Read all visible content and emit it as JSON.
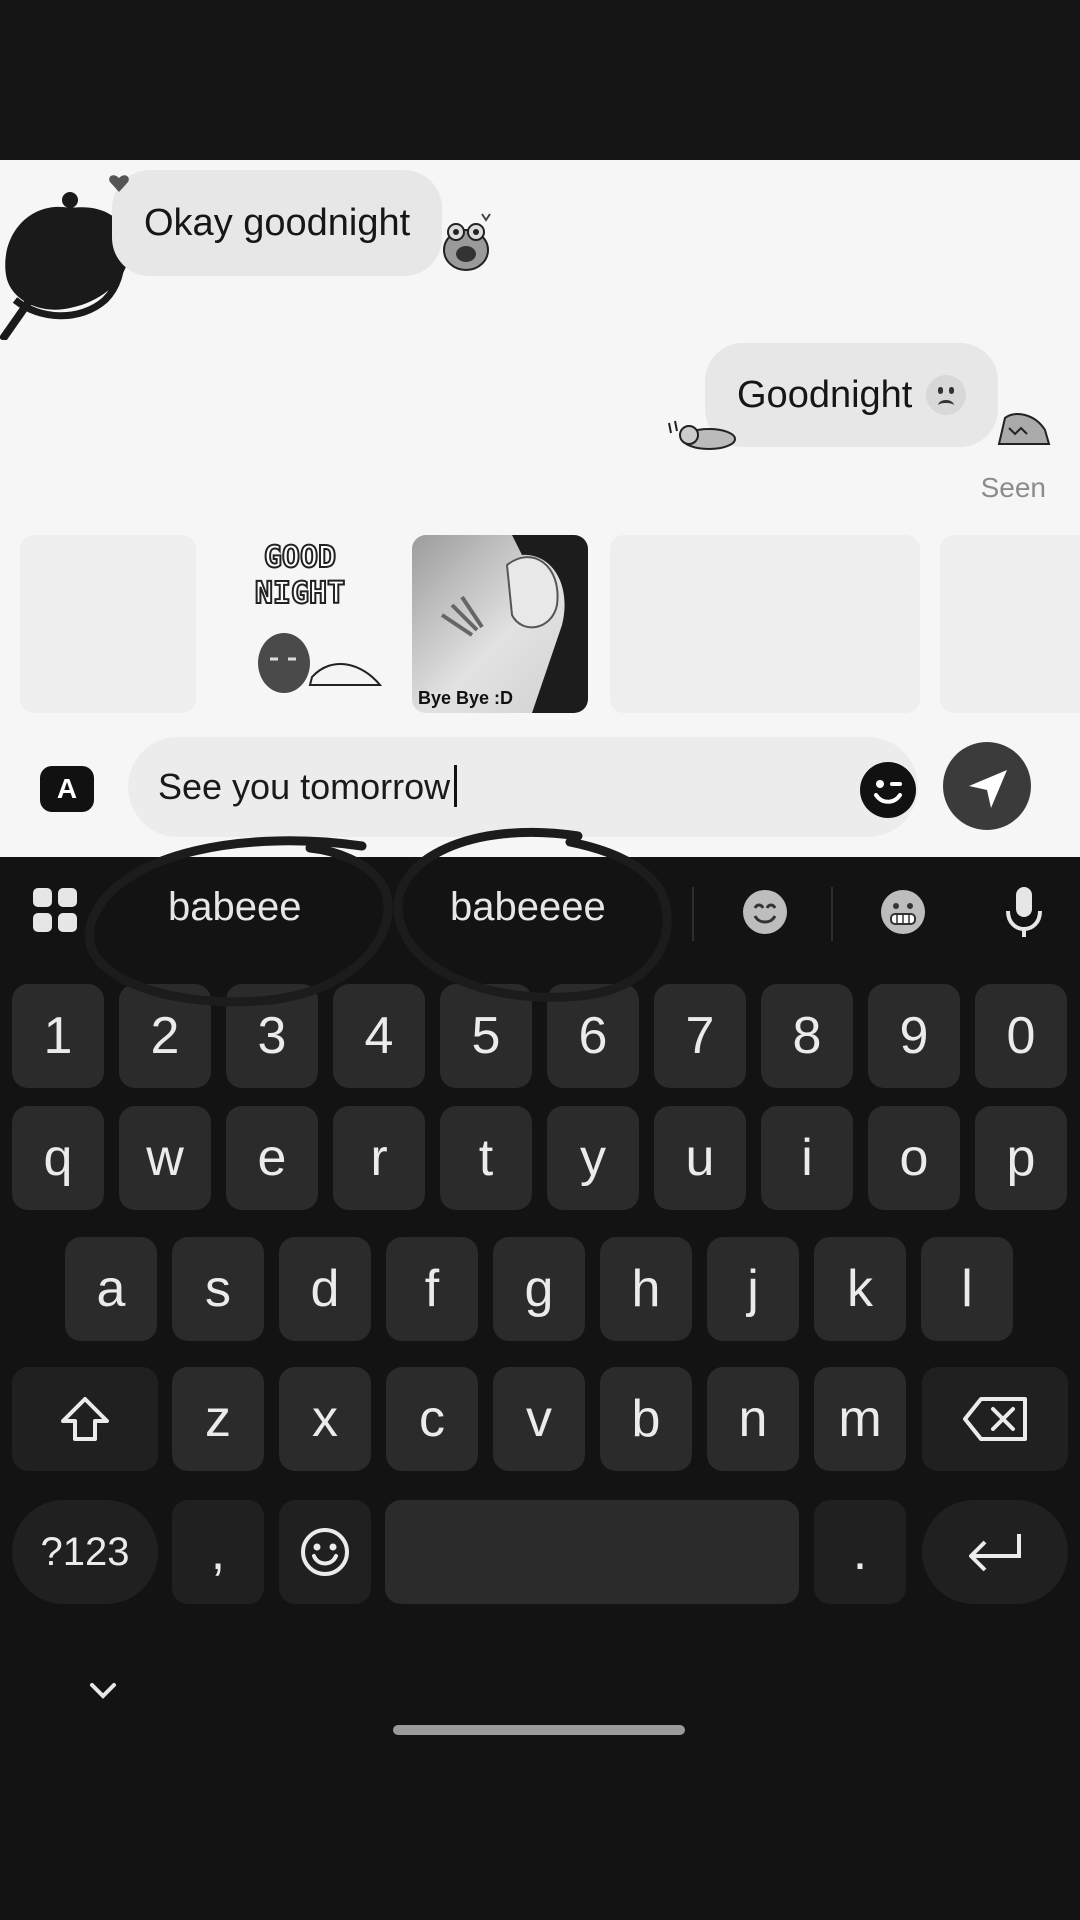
{
  "chat": {
    "incoming_message": "Okay goodnight",
    "outgoing_message": "Goodnight",
    "outgoing_emoji": "slightly-frowning-face",
    "seen_label": "Seen"
  },
  "stickers": {
    "good_night_text_1": "GOOD",
    "good_night_text_2": "NIGHT",
    "bye_caption": "Bye Bye :D"
  },
  "composer": {
    "mode_icon_label": "A",
    "input_value": "See you tomorrow"
  },
  "keyboard": {
    "suggestions": [
      "babeee",
      "babeeee"
    ],
    "number_row": [
      "1",
      "2",
      "3",
      "4",
      "5",
      "6",
      "7",
      "8",
      "9",
      "0"
    ],
    "row1": [
      "q",
      "w",
      "e",
      "r",
      "t",
      "y",
      "u",
      "i",
      "o",
      "p"
    ],
    "row2": [
      "a",
      "s",
      "d",
      "f",
      "g",
      "h",
      "j",
      "k",
      "l"
    ],
    "row3": [
      "z",
      "x",
      "c",
      "v",
      "b",
      "n",
      "m"
    ],
    "symbols_key": "?123",
    "comma_key": ",",
    "period_key": "."
  },
  "colors": {
    "keyboard_bg": "#131313",
    "key_bg": "#2b2b2b",
    "chat_bg": "#f6f6f6",
    "bubble_bg": "#e7e7e7"
  }
}
